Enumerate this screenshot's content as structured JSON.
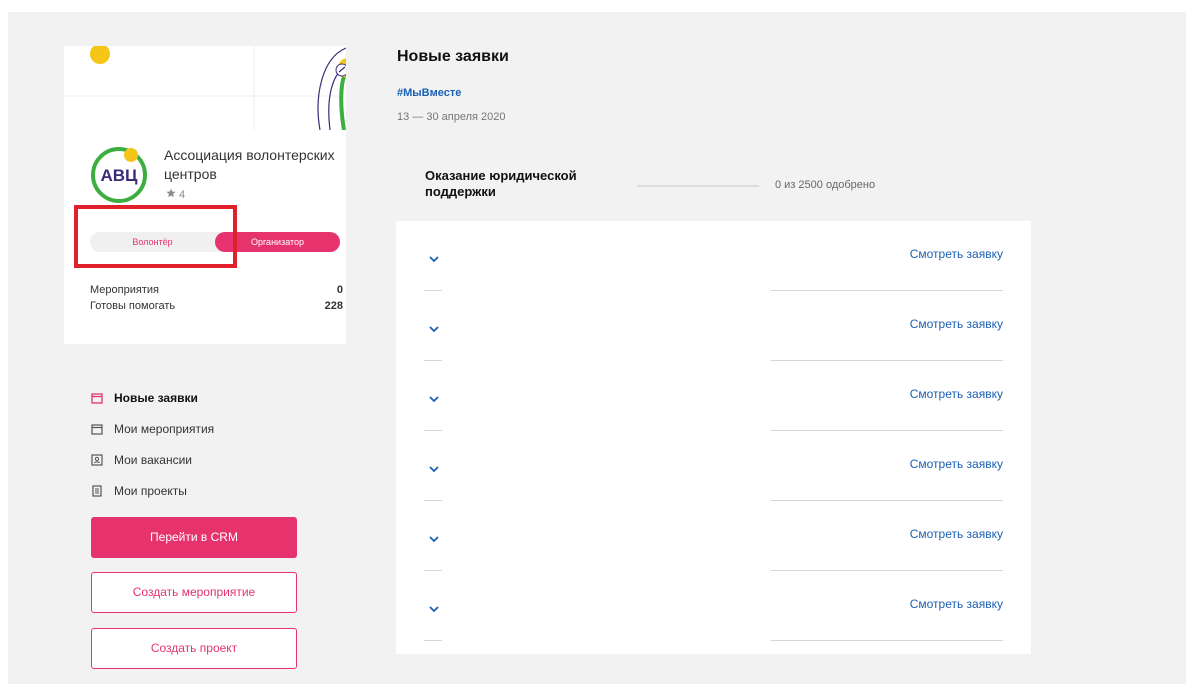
{
  "profile": {
    "org_name": "Ассоциация волонтерских центров",
    "logo_text": "АВЦ",
    "rating": "4",
    "roles": {
      "volunteer": "Волонтёр",
      "organizer": "Организатор",
      "active": "organizer"
    },
    "stats": [
      {
        "label": "Мероприятия",
        "value": "0"
      },
      {
        "label": "Готовы помогать",
        "value": "228"
      }
    ]
  },
  "nav": {
    "items": [
      {
        "label": "Новые заявки",
        "icon": "calendar-icon",
        "active": true
      },
      {
        "label": "Мои мероприятия",
        "icon": "calendar-icon",
        "active": false
      },
      {
        "label": "Мои вакансии",
        "icon": "person-badge-icon",
        "active": false
      },
      {
        "label": "Мои проекты",
        "icon": "document-icon",
        "active": false
      }
    ]
  },
  "actions": {
    "crm": "Перейти в CRM",
    "create_event": "Создать мероприятие",
    "create_project": "Создать проект"
  },
  "main": {
    "title": "Новые заявки",
    "hashtag": "#МыВместе",
    "dates": "13 — 30 апреля 2020",
    "panel": {
      "title": "Оказание юридической поддержки",
      "approved_text": "0 из 2500 одобрено",
      "approved_fraction": 0
    },
    "requests": [
      {
        "link": "Смотреть заявку"
      },
      {
        "link": "Смотреть заявку"
      },
      {
        "link": "Смотреть заявку"
      },
      {
        "link": "Смотреть заявку"
      },
      {
        "link": "Смотреть заявку"
      },
      {
        "link": "Смотреть заявку"
      }
    ]
  },
  "colors": {
    "accent": "#e6336d",
    "link": "#1a5fb4",
    "logo_green": "#3cae3f",
    "logo_yellow": "#f5c518",
    "logo_purple": "#3b2a7a",
    "highlight": "#e0202b"
  }
}
